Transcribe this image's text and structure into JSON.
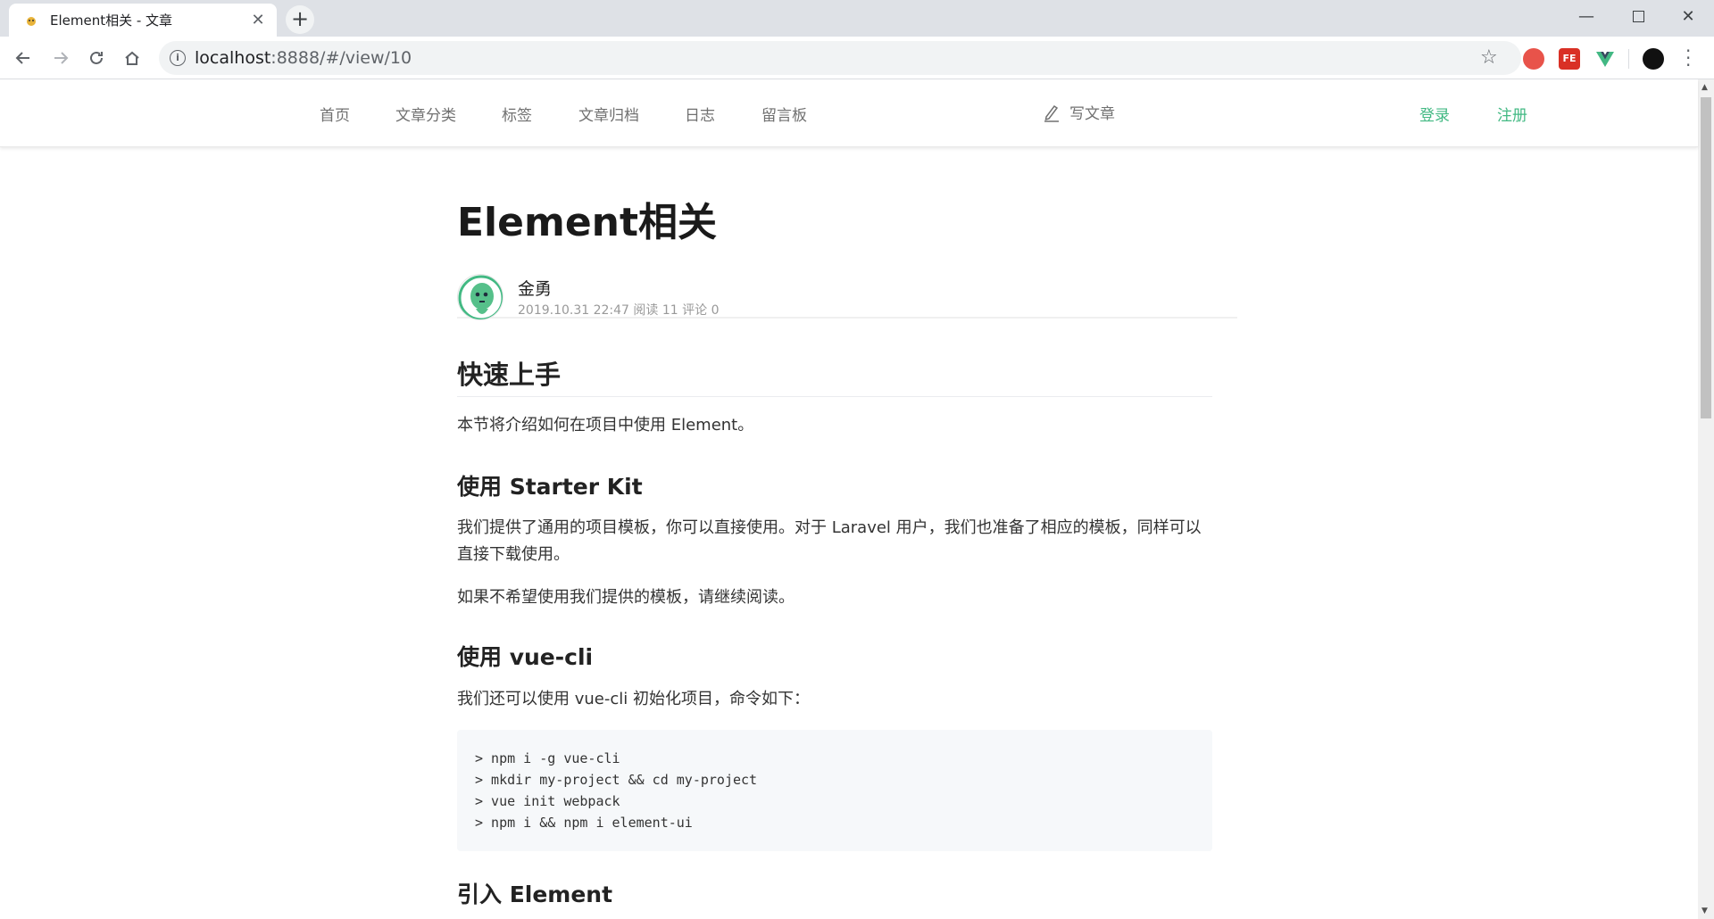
{
  "browser": {
    "tab_title": "Element相关 - 文章",
    "url_host": "localhost",
    "url_rest": ":8888/#/view/10",
    "new_tab": "+",
    "close_tab": "✕"
  },
  "nav": {
    "items": [
      "首页",
      "文章分类",
      "标签",
      "文章归档",
      "日志",
      "留言板"
    ],
    "write_label": "写文章",
    "login_label": "登录",
    "register_label": "注册"
  },
  "colors": {
    "accent": "#42b983"
  },
  "article": {
    "title": "Element相关",
    "author": "金勇",
    "meta": "2019.10.31 22:47 阅读 11 评论 0",
    "h2_quick_start": "快速上手",
    "intro": "本节将介绍如何在项目中使用 Element。",
    "h3_starter_kit": "使用 Starter Kit",
    "starter_p1": "我们提供了通用的项目模板，你可以直接使用。对于 Laravel 用户，我们也准备了相应的模板，同样可以直接下载使用。",
    "starter_p2": "如果不希望使用我们提供的模板，请继续阅读。",
    "h3_vue_cli": "使用 vue-cli",
    "vue_cli_p": "我们还可以使用 vue-cli 初始化项目，命令如下：",
    "code_lines": [
      "> npm i -g vue-cli",
      "> mkdir my-project && cd my-project",
      "> vue init webpack",
      "> npm i && npm i element-ui"
    ],
    "h3_import": "引入 Element"
  }
}
